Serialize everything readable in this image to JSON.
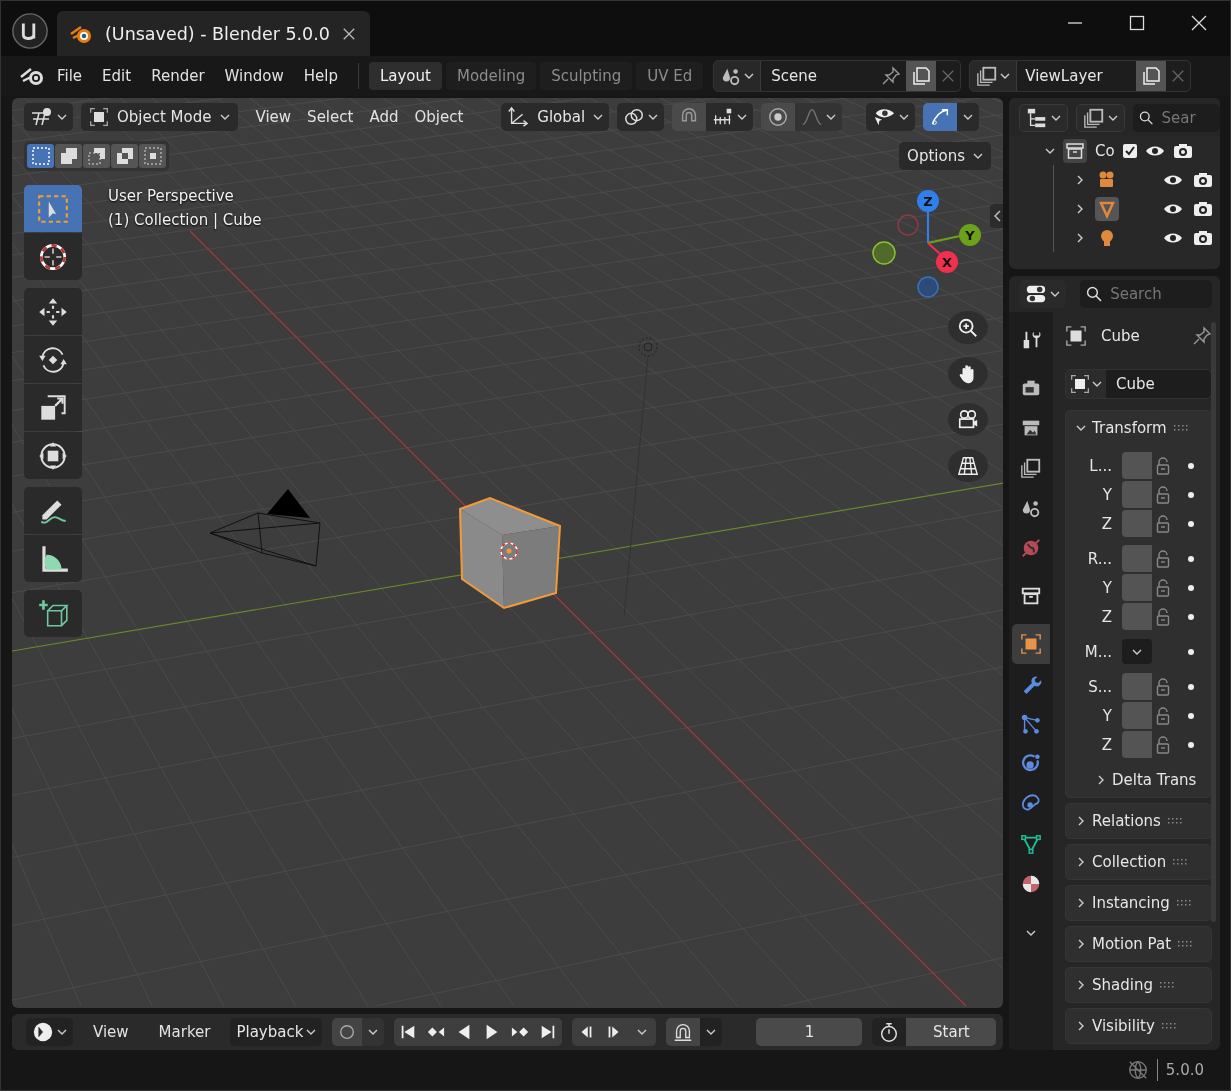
{
  "window": {
    "title": "(Unsaved) - Blender 5.0.0"
  },
  "menu_bar": {
    "menus": [
      "File",
      "Edit",
      "Render",
      "Window",
      "Help"
    ]
  },
  "workspace_tabs": [
    {
      "label": "Layout",
      "selected": true
    },
    {
      "label": "Modeling",
      "selected": false
    },
    {
      "label": "Sculpting",
      "selected": false
    },
    {
      "label": "UV Ed",
      "selected": false
    }
  ],
  "scene_selector": {
    "value": "Scene"
  },
  "view_layer_selector": {
    "value": "ViewLayer"
  },
  "viewport": {
    "mode": "Object Mode",
    "menus": [
      "View",
      "Select",
      "Add",
      "Object"
    ],
    "orientation": "Global",
    "gizmos_on": true,
    "select_modes": [
      {
        "kind": "set",
        "selected": true
      },
      {
        "kind": "extend",
        "selected": false
      },
      {
        "kind": "subtract",
        "selected": false
      },
      {
        "kind": "invert",
        "selected": false
      },
      {
        "kind": "intersect",
        "selected": false
      }
    ],
    "options_label": "Options",
    "overlay_text": [
      "User Perspective",
      "(1) Collection | Cube"
    ],
    "tool_groups": [
      {
        "tools": [
          {
            "kind": "select",
            "selected": true
          },
          {
            "kind": "cursor",
            "selected": false
          }
        ]
      },
      {
        "tools": [
          {
            "kind": "move",
            "selected": false
          },
          {
            "kind": "rotate",
            "selected": false
          },
          {
            "kind": "scale",
            "selected": false
          },
          {
            "kind": "transform",
            "selected": false
          }
        ]
      },
      {
        "tools": [
          {
            "kind": "annotate",
            "selected": false
          },
          {
            "kind": "measure",
            "selected": false
          }
        ]
      },
      {
        "tools": [
          {
            "kind": "add_cube",
            "selected": false
          }
        ]
      }
    ],
    "gizmo_axes": {
      "z": "Z",
      "y": "Y",
      "x": "X"
    }
  },
  "outliner": {
    "search_placeholder": "Sear",
    "tree": [
      {
        "label": "Co",
        "expanded": true,
        "checked": true,
        "children": [
          {
            "kind": "camera",
            "expanded": false,
            "selected": false
          },
          {
            "kind": "mesh",
            "expanded": false,
            "selected": true
          },
          {
            "kind": "light",
            "expanded": false,
            "selected": false
          }
        ]
      }
    ]
  },
  "properties": {
    "search_placeholder": "Search",
    "tabs": [
      {
        "kind": "tool",
        "selected": false
      },
      {
        "kind": "render",
        "selected": false
      },
      {
        "kind": "output",
        "selected": false
      },
      {
        "kind": "view_layer",
        "selected": false
      },
      {
        "kind": "scene",
        "selected": false
      },
      {
        "kind": "world",
        "selected": false
      },
      {
        "kind": "collection",
        "selected": false
      },
      {
        "kind": "object",
        "selected": true
      },
      {
        "kind": "modifiers",
        "selected": false
      },
      {
        "kind": "particles",
        "selected": false
      },
      {
        "kind": "physics",
        "selected": false
      },
      {
        "kind": "constraints",
        "selected": false
      },
      {
        "kind": "data",
        "selected": false
      },
      {
        "kind": "material",
        "selected": false
      }
    ],
    "object_name": "Cube",
    "name_field": "Cube",
    "panels": [
      {
        "title": "Transform",
        "expanded": true,
        "groups": [
          {
            "rows": [
              {
                "label": "L...",
                "kind": "field"
              },
              {
                "label": "Y",
                "kind": "field"
              },
              {
                "label": "Z",
                "kind": "field"
              }
            ]
          },
          {
            "rows": [
              {
                "label": "R...",
                "kind": "field"
              },
              {
                "label": "Y",
                "kind": "field"
              },
              {
                "label": "Z",
                "kind": "field"
              }
            ]
          },
          {
            "rows": [
              {
                "label": "M...",
                "kind": "dropdown"
              }
            ]
          },
          {
            "rows": [
              {
                "label": "S...",
                "kind": "field"
              },
              {
                "label": "Y",
                "kind": "field"
              },
              {
                "label": "Z",
                "kind": "field"
              }
            ]
          }
        ],
        "subpanel": {
          "title": "Delta Trans",
          "expanded": false
        }
      },
      {
        "title": "Relations",
        "expanded": false
      },
      {
        "title": "Collection",
        "expanded": false
      },
      {
        "title": "Instancing",
        "expanded": false
      },
      {
        "title": "Motion Pat",
        "expanded": false
      },
      {
        "title": "Shading",
        "expanded": false
      },
      {
        "title": "Visibility",
        "expanded": false
      }
    ]
  },
  "timeline": {
    "menus": [
      "View",
      "Marker"
    ],
    "playback": "Playback",
    "current_frame": "1",
    "start_label": "Start"
  },
  "status_bar": {
    "version": "5.0.0"
  }
}
